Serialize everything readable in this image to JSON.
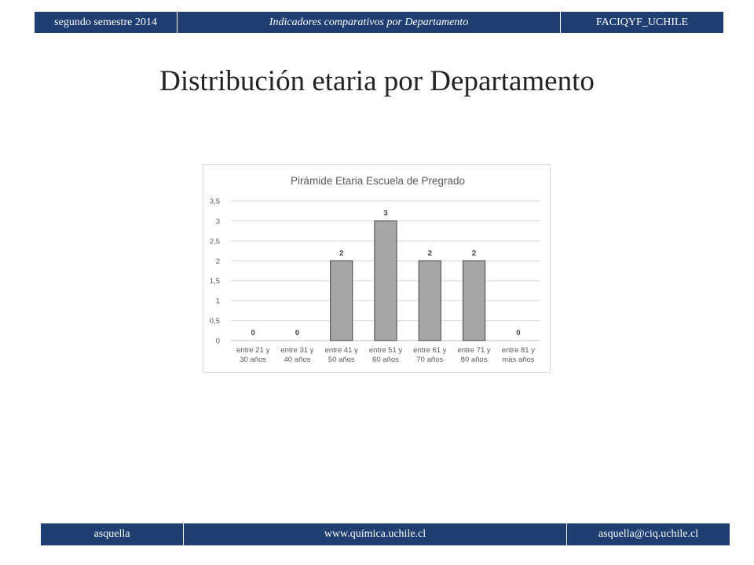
{
  "header": {
    "left": "segundo semestre 2014",
    "center": "Indicadores comparativos por Departamento",
    "right": "FACIQYF_UCHILE"
  },
  "slide_title": "Distribución etaria por Departamento",
  "footer": {
    "left": "asquella",
    "center": "www.química.uchile.cl",
    "right": "asquella@ciq.uchile.cl"
  },
  "colors": {
    "bar_bg": "#1f3f73",
    "bar_fill": "#a6a6a6"
  },
  "chart_data": {
    "type": "bar",
    "title": "Pirámide Etaria Escuela de Pregrado",
    "categories": [
      [
        "entre 21 y",
        "30 años"
      ],
      [
        "entre 31 y",
        "40 años"
      ],
      [
        "entre 41 y",
        "50 años"
      ],
      [
        "entre 51 y",
        "60 años"
      ],
      [
        "entre 61 y",
        "70 años"
      ],
      [
        "entre 71 y",
        "80 años"
      ],
      [
        "entre 81 y",
        "más años"
      ]
    ],
    "values": [
      0,
      0,
      2,
      3,
      2,
      2,
      0
    ],
    "data_labels": [
      "0",
      "0",
      "2",
      "3",
      "2",
      "2",
      "0"
    ],
    "ylim": [
      0,
      3.5
    ],
    "yticks": [
      "0",
      "0,5",
      "1",
      "1,5",
      "2",
      "2,5",
      "3",
      "3,5"
    ],
    "grid": true,
    "xlabel": "",
    "ylabel": ""
  }
}
